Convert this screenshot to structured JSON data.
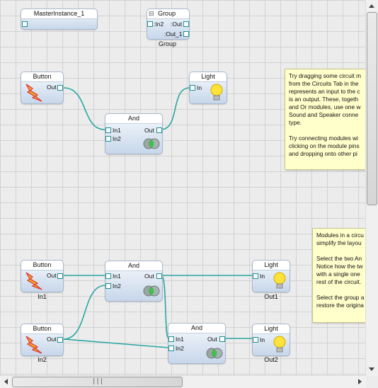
{
  "master_instance": {
    "title": "MasterInstance_1"
  },
  "group_module": {
    "title": "Group",
    "collapse_glyph": "⊟",
    "pin_in2": ":In2",
    "pin_out": ":Out",
    "pin_out1": ":Out_1",
    "label": "Group"
  },
  "circuit1": {
    "button": {
      "title": "Button",
      "out": "Out"
    },
    "and": {
      "title": "And",
      "in1": "In1",
      "in2": "In2",
      "out": "Out"
    },
    "light": {
      "title": "Light",
      "in": "In"
    }
  },
  "circuit2": {
    "button1": {
      "title": "Button",
      "out": "Out",
      "label": "In1"
    },
    "button2": {
      "title": "Button",
      "out": "Out",
      "label": "In2"
    },
    "and1": {
      "title": "And",
      "in1": "In1",
      "in2": "In2",
      "out": "Out"
    },
    "and2": {
      "title": "And",
      "in1": "In1",
      "in2": "In2",
      "out": "Out"
    },
    "light1": {
      "title": "Light",
      "in": "In",
      "label": "Out1"
    },
    "light2": {
      "title": "Light",
      "in": "In",
      "label": "Out2"
    }
  },
  "note1": {
    "lines": [
      "Try dragging some circuit m",
      "from the Circuits Tab in the",
      "represents an input to the c",
      "is an output. These, togeth",
      "and Or modules, use one w",
      "Sound and Speaker conne",
      "type.",
      "",
      "Try connecting modules wi",
      "clicking on the module pins",
      "and dropping onto other pi"
    ]
  },
  "note2": {
    "lines": [
      "Modules in a circu",
      "simplify the layou",
      "",
      "Select the two An",
      "Notice how the tw",
      "with a single one",
      "rest of the circuit.",
      "",
      "Select the group a",
      "restore the origina"
    ]
  },
  "colors": {
    "wire": "#2aa5a0",
    "note_bg": "#ffffcc",
    "grid_bg": "#ececec"
  },
  "icons": {
    "button": "button-lightning-icon",
    "and": "and-gate-icon",
    "light": "lightbulb-icon"
  }
}
